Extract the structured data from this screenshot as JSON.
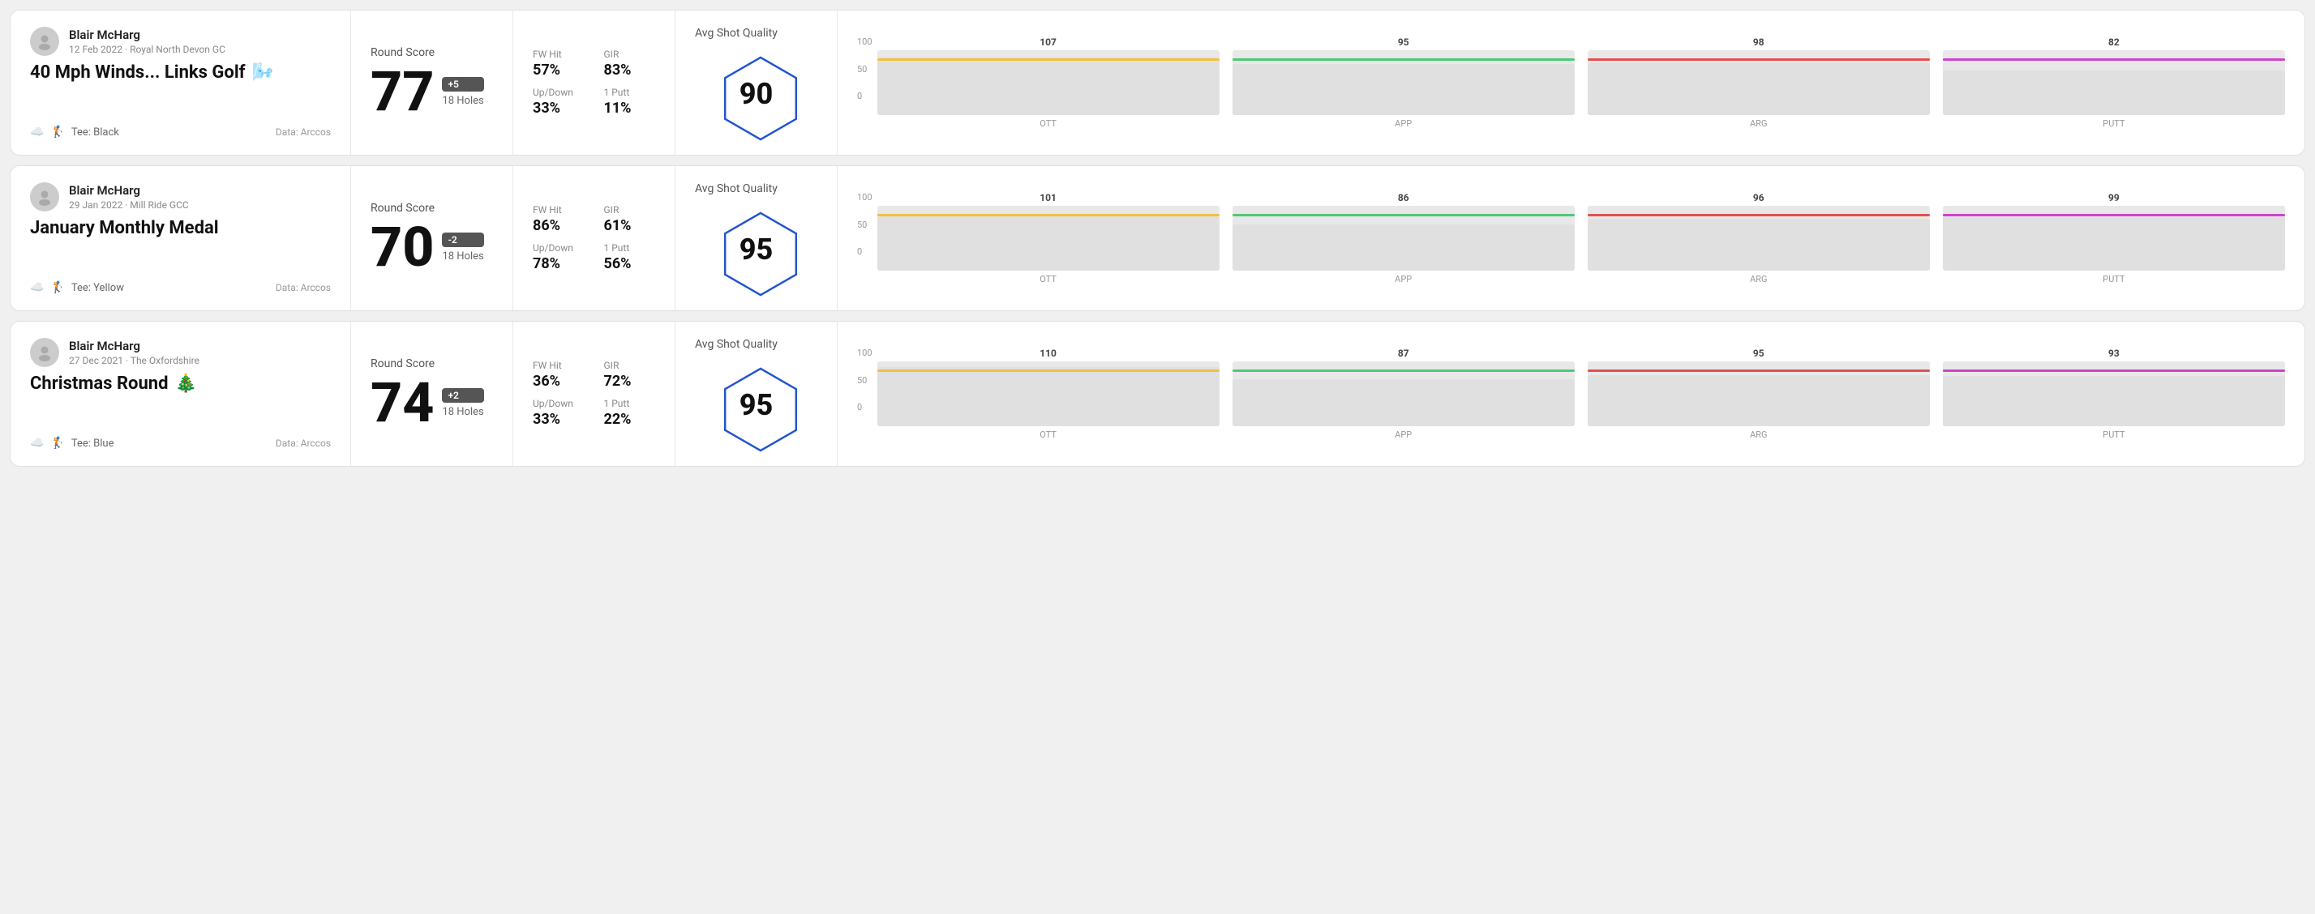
{
  "rounds": [
    {
      "id": "round-1",
      "player": "Blair McHarg",
      "date": "12 Feb 2022 · Royal North Devon GC",
      "title": "40 Mph Winds... Links Golf",
      "title_emoji": "🌬️",
      "tee": "Tee: Black",
      "data_source": "Data: Arccos",
      "score": "77",
      "score_diff": "+5",
      "holes": "18 Holes",
      "fw_hit_label": "FW Hit",
      "fw_hit": "57%",
      "gir_label": "GIR",
      "gir": "83%",
      "updown_label": "Up/Down",
      "updown": "33%",
      "oneputt_label": "1 Putt",
      "oneputt": "11%",
      "quality_label": "Avg Shot Quality",
      "quality_score": "90",
      "chart": {
        "bars": [
          {
            "label": "OTT",
            "value": 107,
            "color": "#f0c040",
            "max": 120
          },
          {
            "label": "APP",
            "value": 95,
            "color": "#50c878",
            "max": 120
          },
          {
            "label": "ARG",
            "value": 98,
            "color": "#e05050",
            "max": 120
          },
          {
            "label": "PUTT",
            "value": 82,
            "color": "#cc44cc",
            "max": 120
          }
        ],
        "y_labels": [
          "100",
          "50",
          "0"
        ]
      }
    },
    {
      "id": "round-2",
      "player": "Blair McHarg",
      "date": "29 Jan 2022 · Mill Ride GCC",
      "title": "January Monthly Medal",
      "title_emoji": "",
      "tee": "Tee: Yellow",
      "data_source": "Data: Arccos",
      "score": "70",
      "score_diff": "-2",
      "holes": "18 Holes",
      "fw_hit_label": "FW Hit",
      "fw_hit": "86%",
      "gir_label": "GIR",
      "gir": "61%",
      "updown_label": "Up/Down",
      "updown": "78%",
      "oneputt_label": "1 Putt",
      "oneputt": "56%",
      "quality_label": "Avg Shot Quality",
      "quality_score": "95",
      "chart": {
        "bars": [
          {
            "label": "OTT",
            "value": 101,
            "color": "#f0c040",
            "max": 120
          },
          {
            "label": "APP",
            "value": 86,
            "color": "#50c878",
            "max": 120
          },
          {
            "label": "ARG",
            "value": 96,
            "color": "#e05050",
            "max": 120
          },
          {
            "label": "PUTT",
            "value": 99,
            "color": "#cc44cc",
            "max": 120
          }
        ],
        "y_labels": [
          "100",
          "50",
          "0"
        ]
      }
    },
    {
      "id": "round-3",
      "player": "Blair McHarg",
      "date": "27 Dec 2021 · The Oxfordshire",
      "title": "Christmas Round",
      "title_emoji": "🎄",
      "tee": "Tee: Blue",
      "data_source": "Data: Arccos",
      "score": "74",
      "score_diff": "+2",
      "holes": "18 Holes",
      "fw_hit_label": "FW Hit",
      "fw_hit": "36%",
      "gir_label": "GIR",
      "gir": "72%",
      "updown_label": "Up/Down",
      "updown": "33%",
      "oneputt_label": "1 Putt",
      "oneputt": "22%",
      "quality_label": "Avg Shot Quality",
      "quality_score": "95",
      "chart": {
        "bars": [
          {
            "label": "OTT",
            "value": 110,
            "color": "#f0c040",
            "max": 120
          },
          {
            "label": "APP",
            "value": 87,
            "color": "#50c878",
            "max": 120
          },
          {
            "label": "ARG",
            "value": 95,
            "color": "#e05050",
            "max": 120
          },
          {
            "label": "PUTT",
            "value": 93,
            "color": "#cc44cc",
            "max": 120
          }
        ],
        "y_labels": [
          "100",
          "50",
          "0"
        ]
      }
    }
  ]
}
